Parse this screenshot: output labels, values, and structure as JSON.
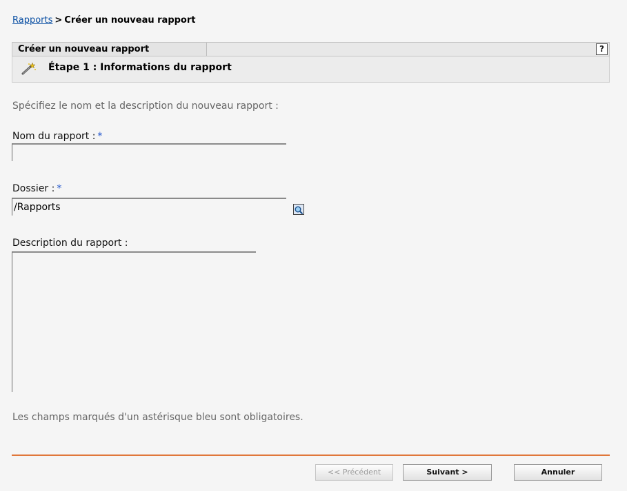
{
  "breadcrumb": {
    "link": "Rapports",
    "separator": ">",
    "current": "Créer un nouveau rapport"
  },
  "panel": {
    "title": "Créer un nouveau rapport",
    "help_label": "?",
    "step_title": "Étape 1 : Informations du rapport",
    "step_icon": "wand-icon"
  },
  "form": {
    "instructions": "Spécifiez le nom et la description du nouveau rapport :",
    "name_label": "Nom du rapport :",
    "name_value": "",
    "folder_label": "Dossier :",
    "folder_value": "/Rapports",
    "browse_icon": "magnifier-icon",
    "description_label": "Description du rapport :",
    "description_value": "",
    "required_marker": "*",
    "required_note": "Les champs marqués d'un astérisque bleu sont obligatoires."
  },
  "buttons": {
    "previous": "<< Précédent",
    "next": "Suivant >",
    "cancel": "Annuler"
  },
  "colors": {
    "link": "#0a4fa3",
    "required": "#2255cc",
    "rule": "#e0773a"
  }
}
